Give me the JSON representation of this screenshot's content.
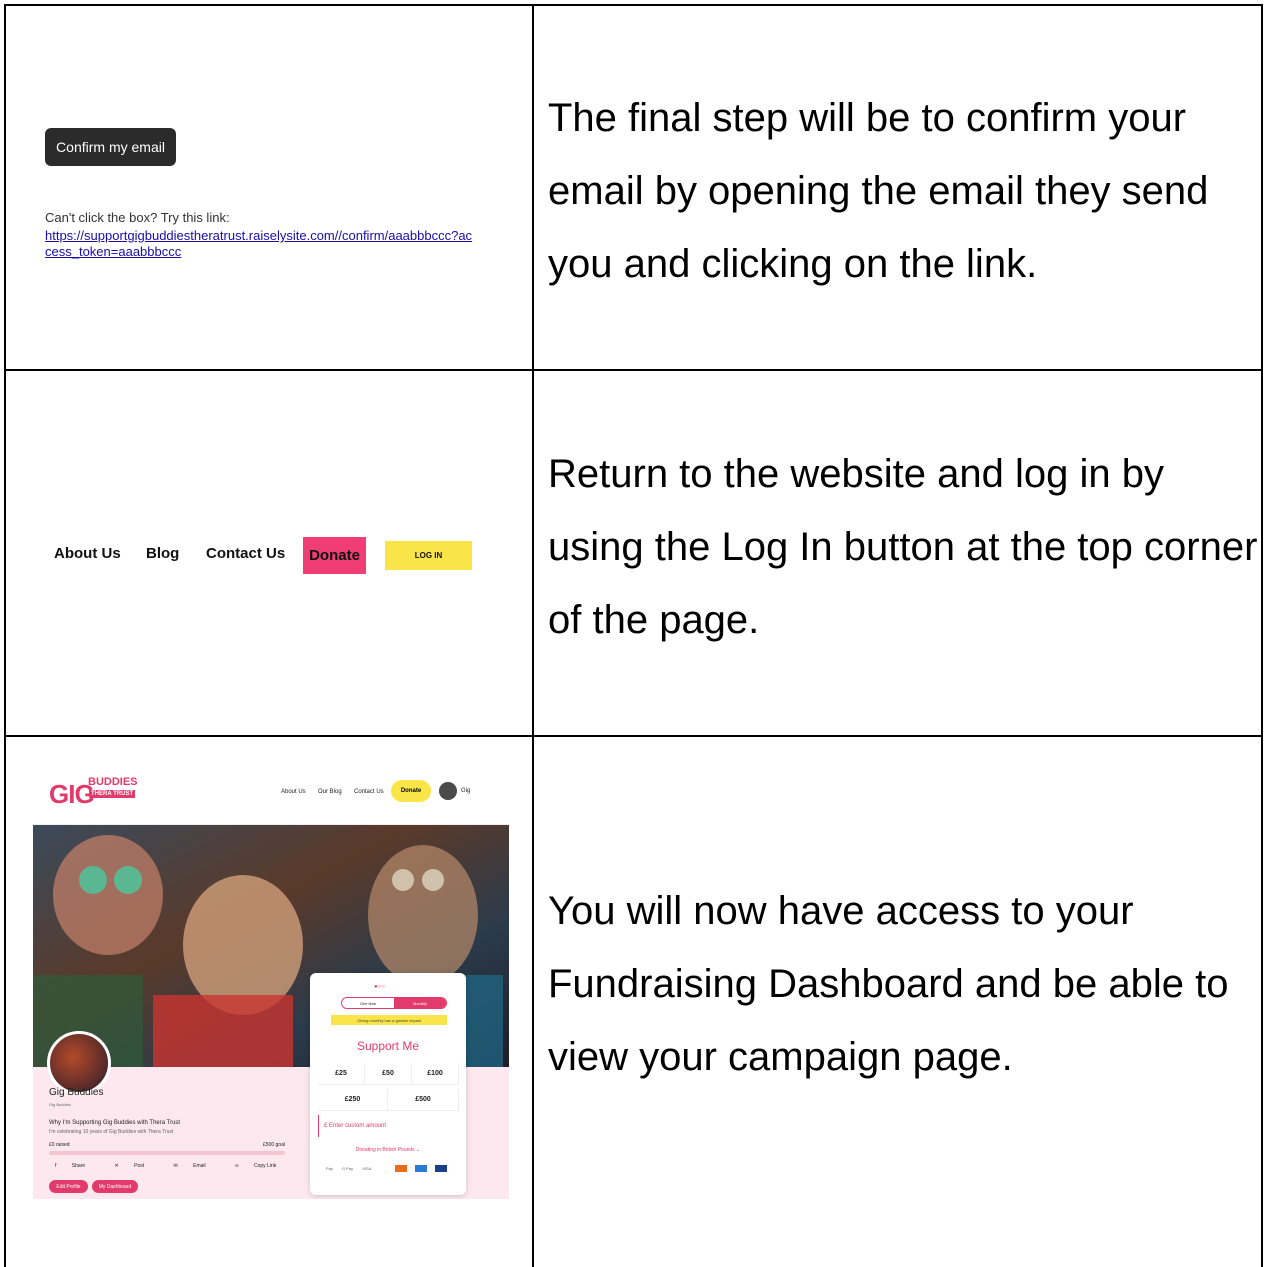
{
  "rows": [
    {
      "text": "The final step will be to confirm your email by opening the email they send you and clicking on the link.",
      "screenshot": {
        "button_label": "Confirm my email",
        "cant_click_text": "Can't click the box? Try this link:",
        "link_text": "https://supportgigbuddiestheratrust.raiselysite.com//confirm/aaabbbccc?access_token=aaabbbccc"
      }
    },
    {
      "text": "Return to the website and log in by using the Log In button at the top corner of the page.",
      "screenshot": {
        "nav": [
          "About Us",
          "Blog",
          "Contact Us"
        ],
        "donate_label": "Donate",
        "login_label": "LOG IN"
      }
    },
    {
      "text": "You will now have access to your Fundraising Dashboard and be able to view your campaign page.",
      "screenshot": {
        "logo_gig": "GIG",
        "logo_buddies": "BUDDIES",
        "logo_thera": "THERA TRUST",
        "nav": [
          "About Us",
          "Our Blog",
          "Contact Us"
        ],
        "donate_label": "Donate",
        "user_name": "Gig",
        "profile_name": "Gig Buddies",
        "profile_sub": "Gig Buddies",
        "why_title": "Why I'm Supporting Gig Buddies with Thera Trust",
        "celebrate_text": "I'm celebrating 10 years of Gig Buddies with Thera Trust",
        "raised": "£0 raised",
        "goal": "£500 goal",
        "progress_fraction": 0,
        "share": [
          "Share",
          "Post",
          "Email",
          "Copy Link"
        ],
        "edit_profile": "Edit Profile",
        "my_dashboard": "My Dashboard",
        "donation_card": {
          "toggle_one_time": "One time",
          "toggle_monthly": "Monthly",
          "note": "Giving monthly has a greater impact",
          "heading": "Support Me",
          "amounts_row1": [
            "£25",
            "£50",
            "£100"
          ],
          "amounts_row2": [
            "£250",
            "£500"
          ],
          "custom_amount": "£ Enter custom amount",
          "currency": "Donating in British Pounds ⌄",
          "payments": [
            "Pay",
            "G Pay",
            "VISA"
          ]
        }
      }
    }
  ],
  "colors": {
    "pink": "#e23b6b",
    "donate_pink": "#ee3e75",
    "yellow": "#f9e547",
    "dark_button": "#2b2b2b",
    "link": "#1a0dab"
  }
}
